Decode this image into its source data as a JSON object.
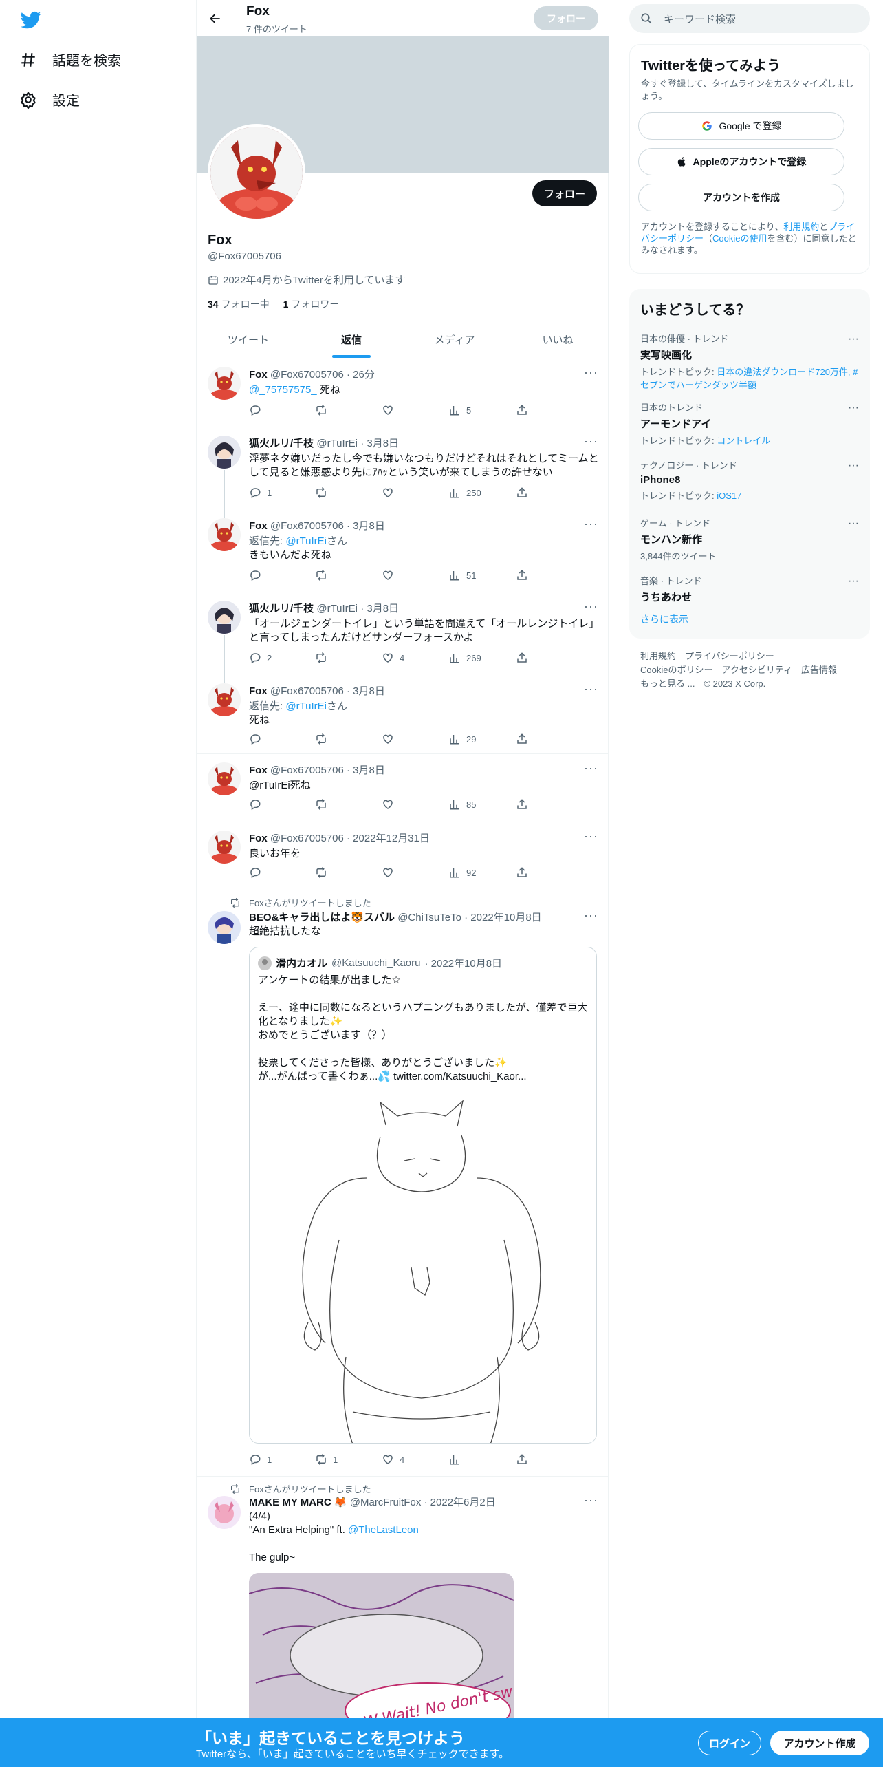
{
  "sidebar": {
    "explore_label": "話題を検索",
    "settings_label": "設定"
  },
  "header": {
    "name": "Fox",
    "tweet_count": "7 件のツイート",
    "follow_label": "フォロー"
  },
  "profile": {
    "name": "Fox",
    "handle": "@Fox67005706",
    "joined": "2022年4月からTwitterを利用しています",
    "following_count": "34",
    "following_label": "フォロー中",
    "followers_count": "1",
    "followers_label": "フォロワー",
    "follow_label": "フォロー"
  },
  "tabs": [
    "ツイート",
    "返信",
    "メディア",
    "いいね"
  ],
  "tweets": [
    {
      "name": "Fox",
      "handle": "@Fox67005706",
      "time": "· 26分",
      "mention": "@_75757575_",
      "text": " 死ね",
      "replies": "",
      "retweets": "",
      "likes": "",
      "views": "5"
    },
    {
      "name": "狐火ルリ/千枝",
      "handle": "@rTuIrEi",
      "time": "· 3月8日",
      "text": "淫夢ネタ嫌いだったし今でも嫌いなつもりだけどそれはそれとしてミームとして見ると嫌悪感より先にｱﾊｯという笑いが来てしまうの許せない",
      "replies": "1",
      "retweets": "",
      "likes": "",
      "views": "250"
    },
    {
      "name": "Fox",
      "handle": "@Fox67005706",
      "time": "· 3月8日",
      "reply_prefix": "返信先: ",
      "reply_to": "@rTuIrEi",
      "reply_suffix": "さん",
      "text": "きもいんだよ死ね",
      "replies": "",
      "retweets": "",
      "likes": "",
      "views": "51"
    },
    {
      "name": "狐火ルリ/千枝",
      "handle": "@rTuIrEi",
      "time": "· 3月8日",
      "text": "「オールジェンダートイレ」という単語を間違えて「オールレンジトイレ」と言ってしまったんだけどサンダーフォースかよ",
      "replies": "2",
      "retweets": "",
      "likes": "4",
      "views": "269"
    },
    {
      "name": "Fox",
      "handle": "@Fox67005706",
      "time": "· 3月8日",
      "reply_prefix": "返信先: ",
      "reply_to": "@rTuIrEi",
      "reply_suffix": "さん",
      "text": "死ね",
      "replies": "",
      "retweets": "",
      "likes": "",
      "views": "29"
    },
    {
      "name": "Fox",
      "handle": "@Fox67005706",
      "time": "· 3月8日",
      "text": "@rTuIrEi死ね",
      "replies": "",
      "retweets": "",
      "likes": "",
      "views": "85"
    },
    {
      "name": "Fox",
      "handle": "@Fox67005706",
      "time": "· 2022年12月31日",
      "text": "良いお年を",
      "replies": "",
      "retweets": "",
      "likes": "",
      "views": "92"
    }
  ],
  "retweet1": {
    "label": "Foxさんがリツイートしました",
    "name": "BEO&キャラ出しはよ🐯スバル",
    "handle": "@ChiTsuTeTo",
    "time": "· 2022年10月8日",
    "text": "超絶拮抗したな",
    "quote_name": "滑内カオル",
    "quote_handle": "@Katsuuchi_Kaoru",
    "quote_time": "· 2022年10月8日",
    "quote_text": "アンケートの結果が出ました☆\n\nえー、途中に同数になるというハプニングもありましたが、僅差で巨大化となりました✨\nおめでとうございます（？）\n\n投票してくださった皆様、ありがとうございました✨\nが...がんばって書くわぁ...💦",
    "quote_link": "twitter.com/Katsuuchi_Kaor...",
    "replies": "1",
    "retweets": "1",
    "likes": "4",
    "views": ""
  },
  "retweet2": {
    "label": "Foxさんがリツイートしました",
    "name": "MAKE MY MARC 🦊",
    "handle": "@MarcFruitFox",
    "time": "· 2022年6月2日",
    "line1": "(4/4)",
    "line2": "\"An Extra Helping\" ft. ",
    "mention": "@TheLastLeon",
    "line3": "The gulp~",
    "image_text": "W-Wait! No don't swal-"
  },
  "right": {
    "search_placeholder": "キーワード検索",
    "signup_title": "Twitterを使ってみよう",
    "signup_sub": "今すぐ登録して、タイムラインをカスタマイズしましょう。",
    "google": "Google で登録",
    "apple": "Appleのアカウントで登録",
    "create": "アカウントを作成",
    "terms_1": "アカウントを登録することにより、",
    "terms_link1": "利用規約",
    "terms_2": "と",
    "terms_link2": "プライバシーポリシー",
    "terms_3": "（",
    "terms_link3": "Cookieの使用",
    "terms_4": "を含む）に同意したとみなされます。",
    "trends_title": "いまどうしてる？",
    "trends": [
      {
        "meta": "日本の俳優 · トレンド",
        "title": "実写映画化",
        "sub_prefix": "トレンドトピック: ",
        "sub_link": "日本の違法ダウンロード720万件, #セブンでハーゲンダッツ半額"
      },
      {
        "meta": "日本のトレンド",
        "title": "アーモンドアイ",
        "sub_prefix": "トレンドトピック: ",
        "sub_link": "コントレイル"
      },
      {
        "meta": "テクノロジー · トレンド",
        "title": "iPhone8",
        "sub_prefix": "トレンドトピック: ",
        "sub_link": "iOS17"
      },
      {
        "meta": "ゲーム · トレンド",
        "title": "モンハン新作",
        "sub_prefix": "3,844件のツイート",
        "sub_link": ""
      },
      {
        "meta": "音楽 · トレンド",
        "title": "うちあわせ",
        "sub_prefix": "",
        "sub_link": ""
      }
    ],
    "show_more": "さらに表示",
    "footer1": "利用規約　プライバシーポリシー",
    "footer2": "Cookieのポリシー　アクセシビリティ　広告情報",
    "footer3": "もっと見る ...　© 2023 X Corp."
  },
  "bottom": {
    "title": "「いま」起きていることを見つけよう",
    "sub": "Twitterなら、「いま」起きていることをいち早くチェックできます。",
    "login": "ログイン",
    "signup": "アカウント作成"
  },
  "colors": {
    "accent": "#1d9bf0",
    "text": "#0f1419",
    "muted": "#536471",
    "banner": "#cfd9de"
  }
}
